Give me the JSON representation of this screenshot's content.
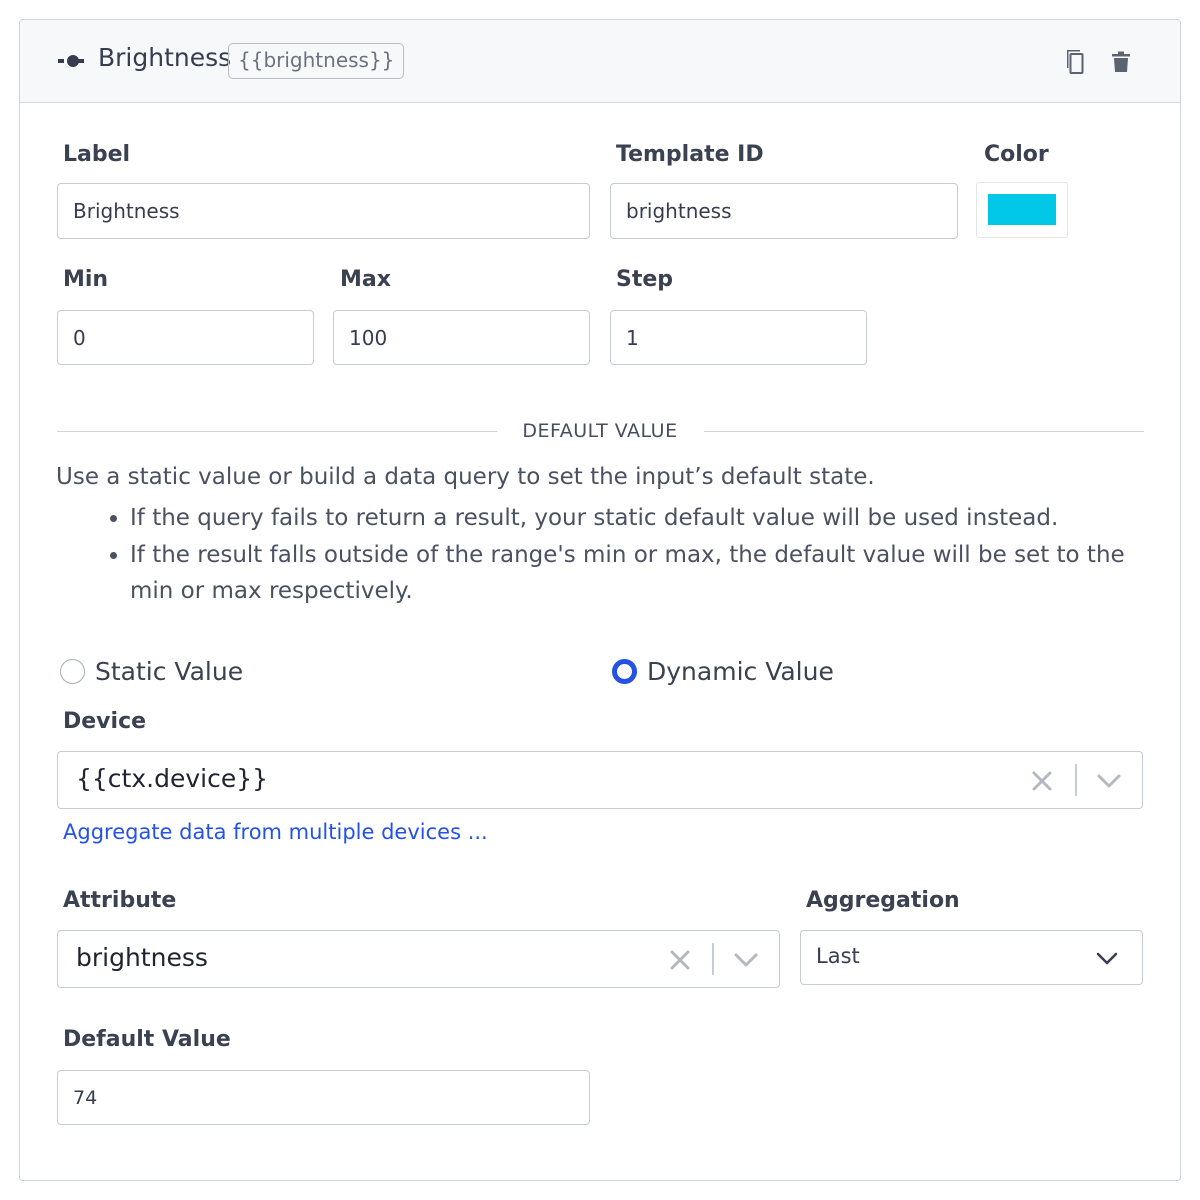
{
  "header": {
    "title": "Brightness",
    "template_badge": "{{brightness}}",
    "icons": [
      "slider-icon",
      "copy-icon",
      "trash-icon"
    ]
  },
  "fields": {
    "label": {
      "label": "Label",
      "value": "Brightness"
    },
    "template_id": {
      "label": "Template ID",
      "value": "brightness"
    },
    "color": {
      "label": "Color",
      "value": "#00c8e6"
    },
    "min": {
      "label": "Min",
      "value": "0"
    },
    "max": {
      "label": "Max",
      "value": "100"
    },
    "step": {
      "label": "Step",
      "value": "1"
    }
  },
  "default_section": {
    "heading": "DEFAULT VALUE",
    "description": "Use a static value or build a data query to set the input’s default state.",
    "bullets": [
      "If the query fails to return a result, your static default value will be used instead.",
      "If the result falls outside of the range's min or max, the default value will be set to the min or max respectively."
    ]
  },
  "mode": {
    "static_label": "Static Value",
    "dynamic_label": "Dynamic Value",
    "selected": "dynamic"
  },
  "device": {
    "label": "Device",
    "value": "{{ctx.device}}",
    "aggregate_link": "Aggregate data from multiple devices ..."
  },
  "attribute": {
    "label": "Attribute",
    "value": "brightness"
  },
  "aggregation": {
    "label": "Aggregation",
    "value": "Last"
  },
  "default_value": {
    "label": "Default Value",
    "value": "74"
  },
  "colors": {
    "accent": "#2451e6",
    "link": "#2452e8",
    "swatch": "#00c8e6"
  }
}
